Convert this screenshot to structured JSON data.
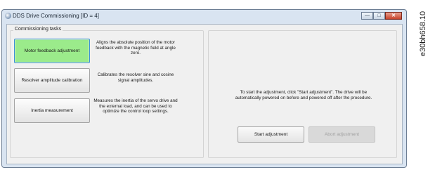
{
  "window": {
    "title": "DDS Drive Commissioning [ID = 4]",
    "app_icon": "app-icon"
  },
  "commissioning_tasks": {
    "legend": "Commissioning tasks",
    "tasks": [
      {
        "label": "Motor feedback adjustment",
        "description": "Aligns the absolute position of the motor feedback with the magnetic field at angle zero.",
        "selected": true
      },
      {
        "label": "Resolver amplitude calibration",
        "description": "Calibrates the resolver sine and cosine signal amplitudes.",
        "selected": false
      },
      {
        "label": "Inertia measurement",
        "description": "Measures the inertia of the servo drive and the external load, and can be used to optimize the control loop settings.",
        "selected": false
      }
    ]
  },
  "adjustment_panel": {
    "instructions": "To start the adjustment, click \"Start adjustment\". The drive will be automatically powered on before and powered off after the procedure.",
    "start_label": "Start adjustment",
    "abort_label": "Abort adjustment",
    "abort_enabled": false
  },
  "figure_reference": "e30bh658.10",
  "colors": {
    "selected_task": "#9beb8b",
    "window_frame": "#d9e4f1",
    "close_button": "#c7432b"
  }
}
